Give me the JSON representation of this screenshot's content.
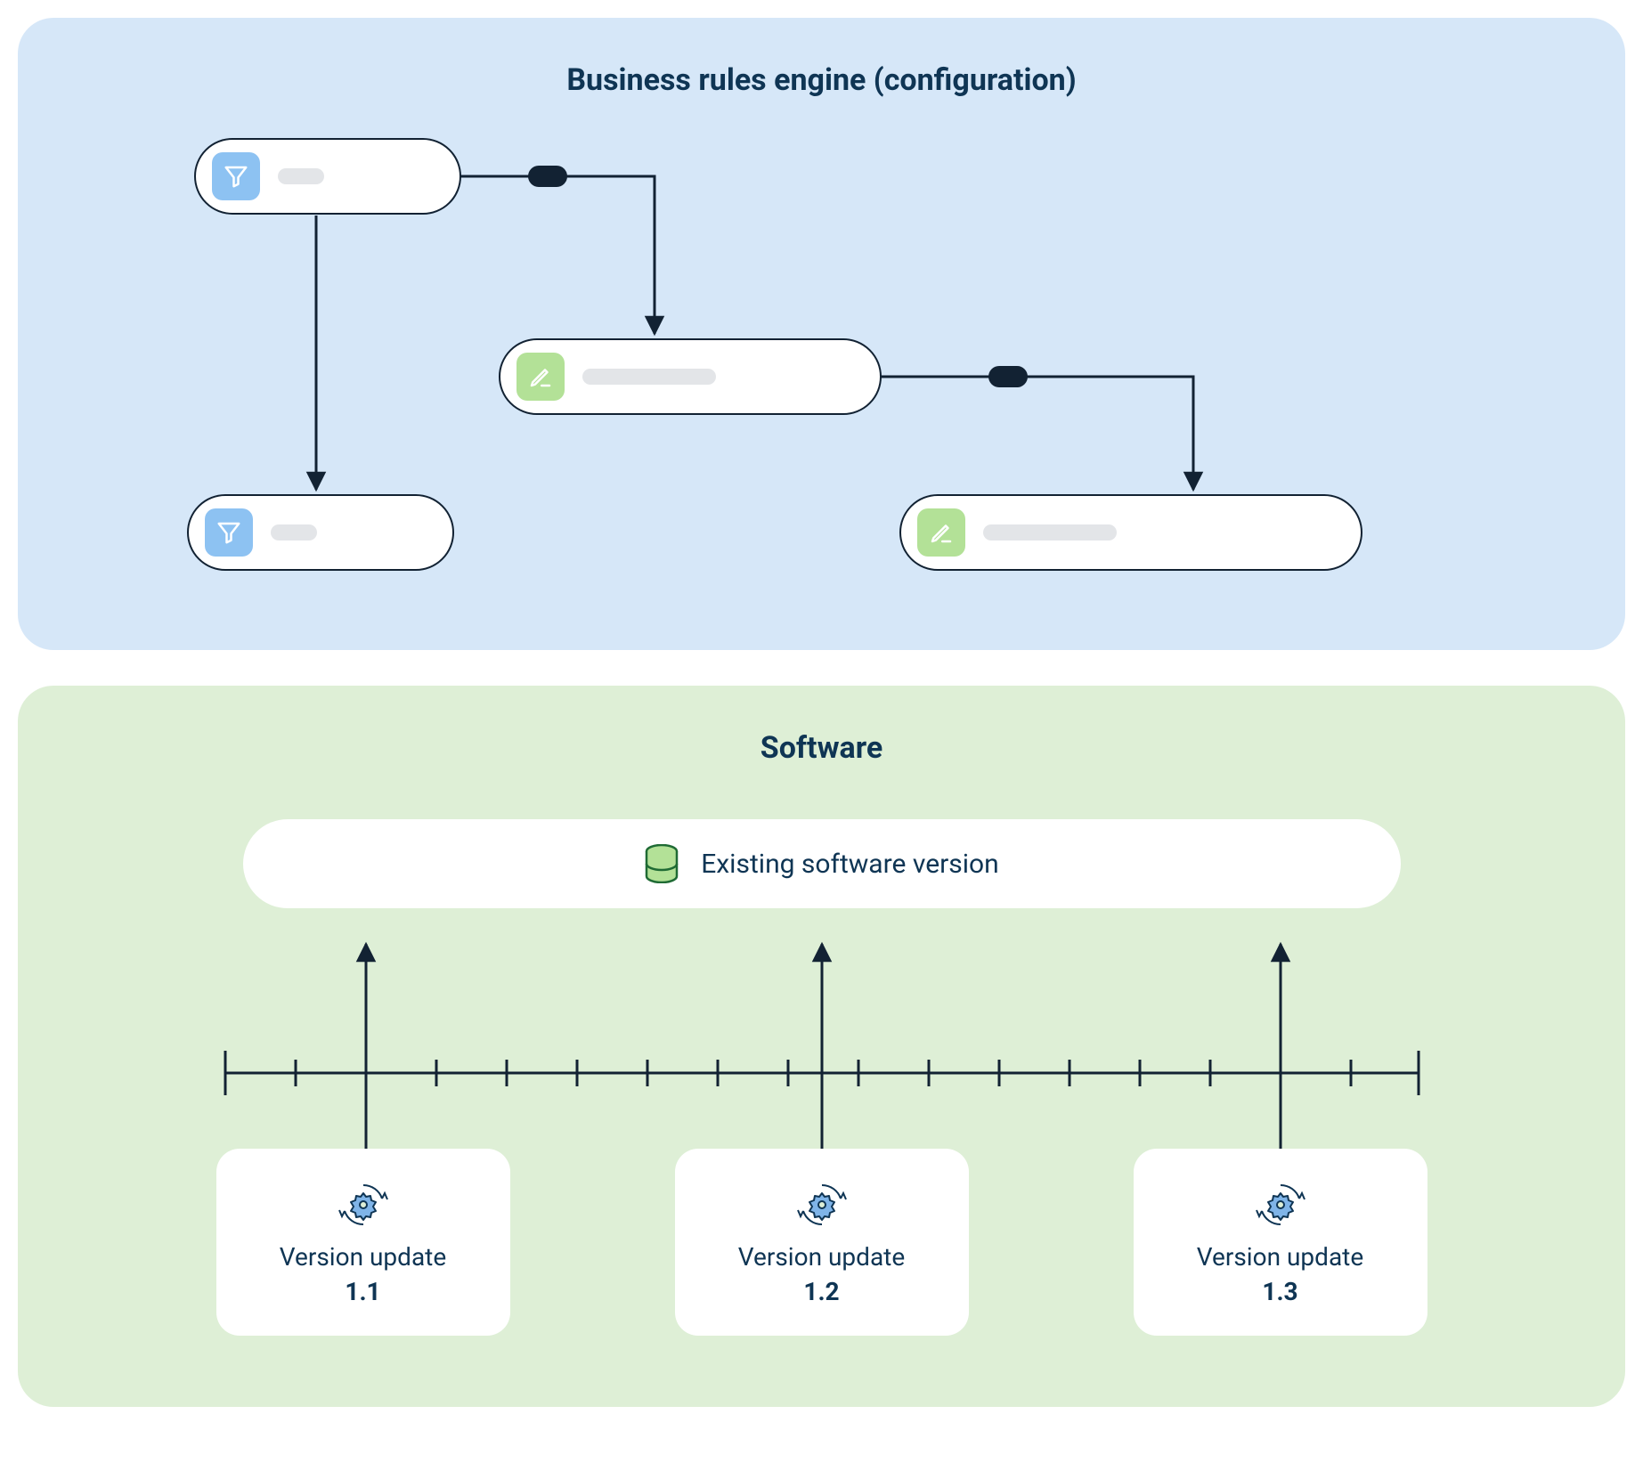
{
  "panels": {
    "rules": {
      "title": "Business rules engine (configuration)"
    },
    "software": {
      "title": "Software",
      "existing_label": "Existing software version",
      "versions": [
        {
          "label": "Version update",
          "number": "1.1"
        },
        {
          "label": "Version update",
          "number": "1.2"
        },
        {
          "label": "Version update",
          "number": "1.3"
        }
      ]
    }
  },
  "colors": {
    "panel_blue": "#d6e7f8",
    "panel_green": "#deefd6",
    "text_navy": "#0f3554",
    "outline_dark": "#122233",
    "icon_blue": "#8dc2f2",
    "icon_green": "#b3e197",
    "placeholder_gray": "#e3e5e8",
    "gear_blue": "#7fb4e8"
  },
  "flow": {
    "nodes": [
      {
        "id": "filter-a",
        "type": "filter",
        "placeholder_width": 52
      },
      {
        "id": "action-a",
        "type": "action",
        "placeholder_width": 150
      },
      {
        "id": "filter-b",
        "type": "filter",
        "placeholder_width": 52
      },
      {
        "id": "action-b",
        "type": "action",
        "placeholder_width": 150
      }
    ],
    "connections": [
      {
        "from": "filter-a",
        "to": "action-a",
        "label_badge": true
      },
      {
        "from": "filter-a",
        "to": "filter-b",
        "label_badge": false
      },
      {
        "from": "action-a",
        "to": "action-b",
        "label_badge": true
      }
    ]
  }
}
